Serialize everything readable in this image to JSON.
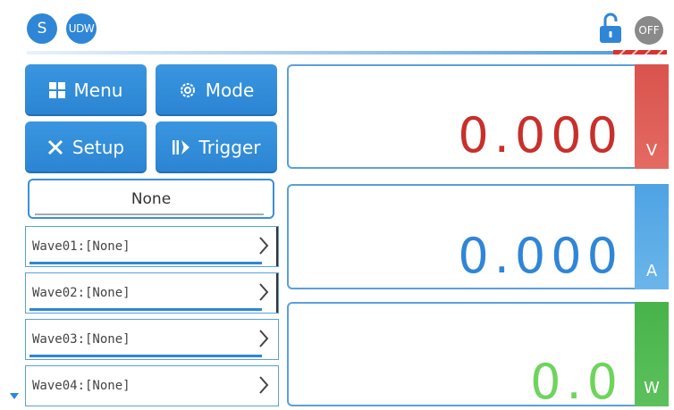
{
  "status": {
    "badge_s": "S",
    "badge_udw": "UDW",
    "output_state": "OFF"
  },
  "buttons": {
    "menu": "Menu",
    "mode": "Mode",
    "setup": "Setup",
    "trigger": "Trigger"
  },
  "selection": {
    "current": "None"
  },
  "waves": [
    {
      "label": "Wave01:[None]"
    },
    {
      "label": "Wave02:[None]"
    },
    {
      "label": "Wave03:[None]"
    },
    {
      "label": "Wave04:[None]"
    }
  ],
  "readings": {
    "voltage": {
      "value": "0.000",
      "unit": "V",
      "color": "#c8302b"
    },
    "current": {
      "value": "0.000",
      "unit": "A",
      "color": "#2f86d6"
    },
    "power": {
      "value": "0.0",
      "unit": "W",
      "color": "#6fd45c"
    }
  },
  "icons": [
    "grid-icon",
    "gear-icon",
    "tools-icon",
    "trigger-icon",
    "unlock-icon",
    "chevron-right-icon"
  ]
}
